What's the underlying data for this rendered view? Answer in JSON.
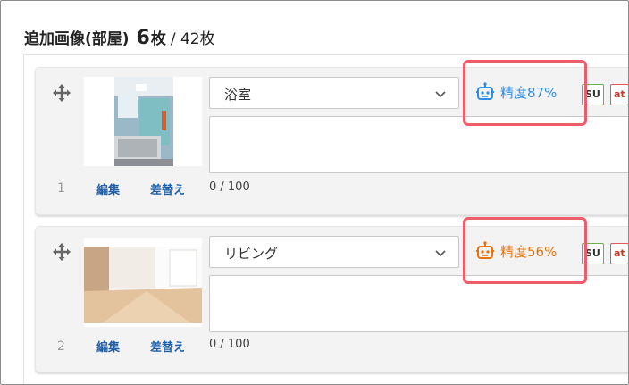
{
  "header": {
    "title": "追加画像(部屋)",
    "count": "6",
    "count_unit": "枚",
    "total": "/ 42枚"
  },
  "colors": {
    "accent_blue": "#2d8ce3",
    "accent_orange": "#e8730c",
    "highlight": "#ef5d6a",
    "link": "#1f5fa8"
  },
  "images": [
    {
      "index": "1",
      "room_select": "浴室",
      "accuracy": "精度87%",
      "accuracy_level": "high",
      "edit_label": "編集",
      "replace_label": "差替え",
      "char_counter": "0 / 100",
      "tags": [
        "SU",
        "at"
      ],
      "robot_icon": "robot-icon"
    },
    {
      "index": "2",
      "room_select": "リビング",
      "accuracy": "精度56%",
      "accuracy_level": "medium",
      "edit_label": "編集",
      "replace_label": "差替え",
      "char_counter": "0 / 100",
      "tags": [
        "SU",
        "at"
      ],
      "robot_icon": "robot-icon"
    }
  ]
}
